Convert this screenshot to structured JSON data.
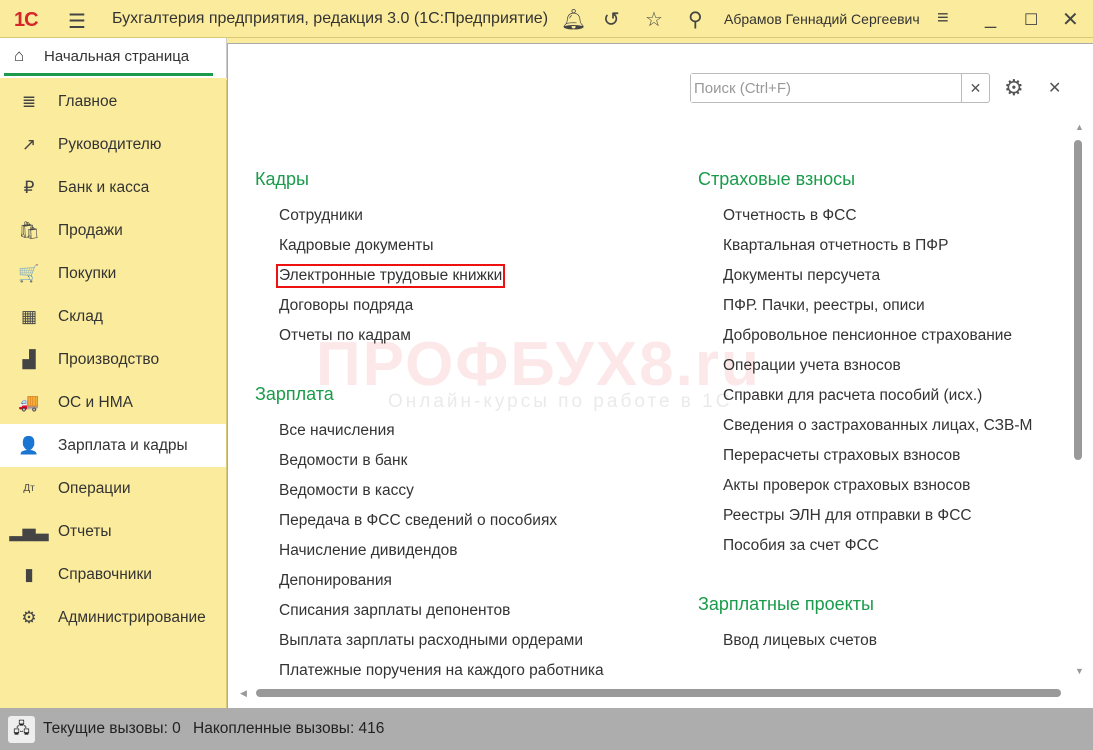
{
  "titlebar": {
    "logo": "1С",
    "title": "Бухгалтерия предприятия, редакция 3.0  (1С:Предприятие)",
    "user": "Абрамов Геннадий Сергеевич"
  },
  "tab": {
    "label": "Начальная страница"
  },
  "sidebar": {
    "items": [
      {
        "label": "Главное",
        "icon": "≣"
      },
      {
        "label": "Руководителю",
        "icon": "↗"
      },
      {
        "label": "Банк и касса",
        "icon": "₽"
      },
      {
        "label": "Продажи",
        "icon": "🛍"
      },
      {
        "label": "Покупки",
        "icon": "🛒"
      },
      {
        "label": "Склад",
        "icon": "▦"
      },
      {
        "label": "Производство",
        "icon": "▟"
      },
      {
        "label": "ОС и НМА",
        "icon": "🚚"
      },
      {
        "label": "Зарплата и кадры",
        "icon": "👤"
      },
      {
        "label": "Операции",
        "icon": "Дт"
      },
      {
        "label": "Отчеты",
        "icon": "▂▅▃"
      },
      {
        "label": "Справочники",
        "icon": "▮"
      },
      {
        "label": "Администрирование",
        "icon": "⚙"
      }
    ]
  },
  "search": {
    "placeholder": "Поиск (Ctrl+F)"
  },
  "left": {
    "kadry": {
      "title": "Кадры",
      "items": [
        "Сотрудники",
        "Кадровые документы",
        "Электронные трудовые книжки",
        "Договоры подряда",
        "Отчеты по кадрам"
      ]
    },
    "zarplata": {
      "title": "Зарплата",
      "items": [
        "Все начисления",
        "Ведомости в банк",
        "Ведомости в кассу",
        "Передача в ФСС сведений о пособиях",
        "Начисление дивидендов",
        "Депонирования",
        "Списания зарплаты депонентов",
        "Выплата зарплаты расходными ордерами",
        "Платежные поручения на каждого работника"
      ]
    }
  },
  "right": {
    "vznosy": {
      "title": "Страховые взносы",
      "items": [
        "Отчетность в ФСС",
        "Квартальная отчетность в ПФР",
        "Документы персучета",
        "ПФР. Пачки, реестры, описи",
        "Добровольное пенсионное страхование",
        "Операции учета взносов",
        "Справки для расчета пособий (исх.)",
        "Сведения о застрахованных лицах, СЗВ-М",
        "Перерасчеты страховых взносов",
        "Акты проверок страховых взносов",
        "Реестры ЭЛН для отправки в ФСС",
        "Пособия за счет ФСС"
      ]
    },
    "projects": {
      "title": "Зарплатные проекты",
      "items": [
        "Ввод лицевых счетов"
      ]
    }
  },
  "watermark": {
    "brand": "ПРОФБУХ8.ru",
    "tagline": "Онлайн-курсы по работе в 1С"
  },
  "status": {
    "current": "Текущие вызовы: 0",
    "accumulated": "Накопленные вызовы: 416"
  },
  "colors": {
    "accent": "#1a9b4b",
    "panel": "#fbec9d",
    "highlight": "#e11111"
  }
}
